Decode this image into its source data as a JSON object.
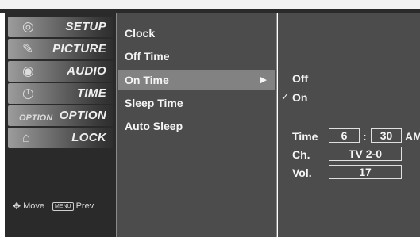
{
  "categories": [
    {
      "label": "SETUP",
      "icon": "satellite-dish-icon",
      "glyph": "◎"
    },
    {
      "label": "PICTURE",
      "icon": "palette-icon",
      "glyph": "✎"
    },
    {
      "label": "AUDIO",
      "icon": "cd-disc-icon",
      "glyph": "◉"
    },
    {
      "label": "TIME",
      "icon": "clock-icon",
      "glyph": "◷"
    },
    {
      "label": "OPTION",
      "icon": "option-badge-icon",
      "glyph": "OPTION"
    },
    {
      "label": "LOCK",
      "icon": "padlock-icon",
      "glyph": "⌂"
    }
  ],
  "nav_hint": {
    "move_label": "Move",
    "menu_key": "MENU",
    "prev_label": "Prev"
  },
  "menu_items": [
    {
      "label": "Clock",
      "selected": false
    },
    {
      "label": "Off Time",
      "selected": false
    },
    {
      "label": "On Time",
      "selected": true
    },
    {
      "label": "Sleep Time",
      "selected": false
    },
    {
      "label": "Auto Sleep",
      "selected": false
    }
  ],
  "selected_arrow": "▶",
  "options": {
    "off": "Off",
    "on": "On",
    "checkmark": "✓"
  },
  "settings": {
    "time_label": "Time",
    "hour": "6",
    "colon": ":",
    "minute": "30",
    "ampm": "AM",
    "ch_label": "Ch.",
    "ch_value": "TV 2-0",
    "vol_label": "Vol.",
    "vol_value": "17"
  },
  "colors": {
    "panel_bg": "#4c4c4c",
    "selected_bg": "#828282",
    "category_bg": "#2a2a2a"
  }
}
